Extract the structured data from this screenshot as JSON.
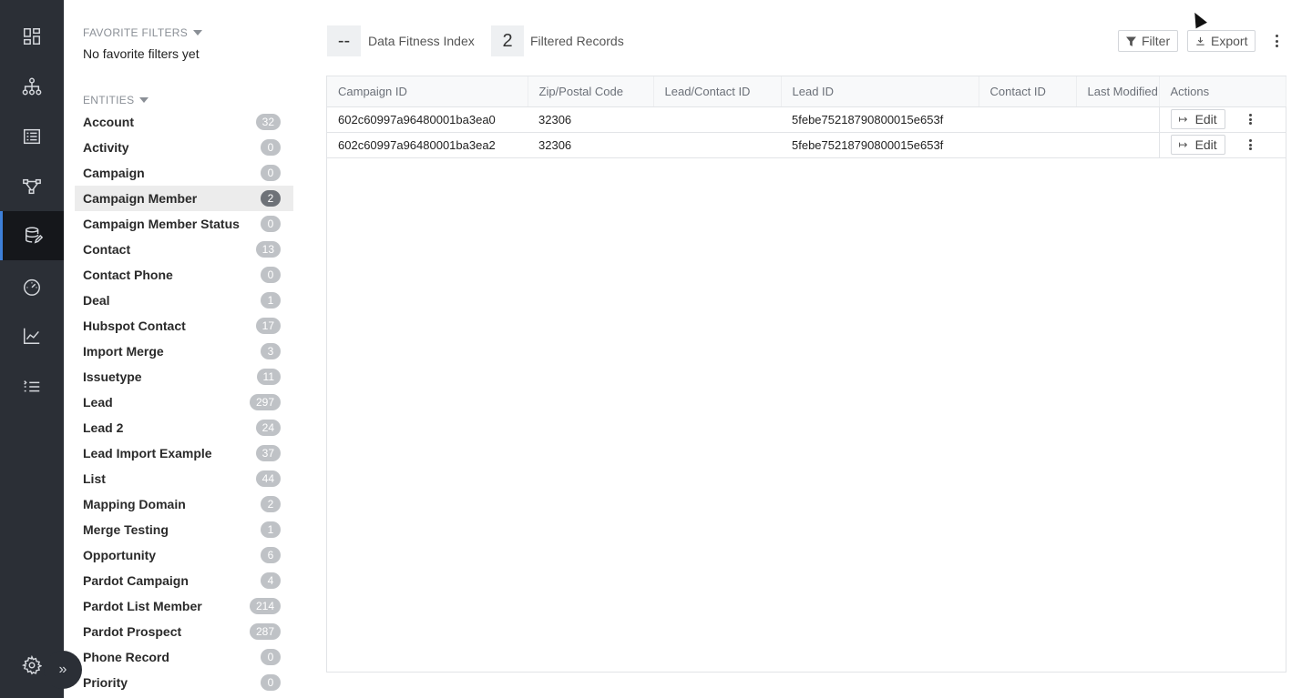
{
  "rail": {
    "items": [
      {
        "icon": "dashboard-icon"
      },
      {
        "icon": "hierarchy-icon"
      },
      {
        "icon": "list-view-icon"
      },
      {
        "icon": "workflow-icon"
      },
      {
        "icon": "database-edit-icon",
        "active": true
      },
      {
        "icon": "speedometer-icon"
      },
      {
        "icon": "line-chart-icon"
      },
      {
        "icon": "task-list-icon"
      }
    ],
    "settings_icon": "gear-icon",
    "expand_label": "»"
  },
  "sidebar": {
    "favorites_title": "FAVORITE FILTERS",
    "favorites_empty": "No favorite filters yet",
    "entities_title": "ENTITIES",
    "entities": [
      {
        "name": "Account",
        "count": "32"
      },
      {
        "name": "Activity",
        "count": "0"
      },
      {
        "name": "Campaign",
        "count": "0"
      },
      {
        "name": "Campaign Member",
        "count": "2",
        "active": true
      },
      {
        "name": "Campaign Member Status",
        "count": "0"
      },
      {
        "name": "Contact",
        "count": "13"
      },
      {
        "name": "Contact Phone",
        "count": "0"
      },
      {
        "name": "Deal",
        "count": "1"
      },
      {
        "name": "Hubspot Contact",
        "count": "17"
      },
      {
        "name": "Import Merge",
        "count": "3"
      },
      {
        "name": "Issuetype",
        "count": "11"
      },
      {
        "name": "Lead",
        "count": "297"
      },
      {
        "name": "Lead 2",
        "count": "24"
      },
      {
        "name": "Lead Import Example",
        "count": "37"
      },
      {
        "name": "List",
        "count": "44"
      },
      {
        "name": "Mapping Domain",
        "count": "2"
      },
      {
        "name": "Merge Testing",
        "count": "1"
      },
      {
        "name": "Opportunity",
        "count": "6"
      },
      {
        "name": "Pardot Campaign",
        "count": "4"
      },
      {
        "name": "Pardot List Member",
        "count": "214"
      },
      {
        "name": "Pardot Prospect",
        "count": "287"
      },
      {
        "name": "Phone Record",
        "count": "0"
      },
      {
        "name": "Priority",
        "count": "0"
      }
    ]
  },
  "stats": {
    "fitness_value": "--",
    "fitness_label": "Data Fitness Index",
    "filtered_value": "2",
    "filtered_label": "Filtered Records"
  },
  "toolbar": {
    "filter_label": "Filter",
    "export_label": "Export"
  },
  "table": {
    "columns": [
      "Campaign ID",
      "Zip/Postal Code",
      "Lead/Contact ID",
      "Lead ID",
      "Contact ID",
      "Last Modified",
      "Actions"
    ],
    "rows": [
      {
        "campaign_id": "602c60997a96480001ba3ea0",
        "zip": "32306",
        "lead_contact_id": "",
        "lead_id": "5febe75218790800015e653f",
        "contact_id": "",
        "last_modified": "",
        "edit_label": "Edit"
      },
      {
        "campaign_id": "602c60997a96480001ba3ea2",
        "zip": "32306",
        "lead_contact_id": "",
        "lead_id": "5febe75218790800015e653f",
        "contact_id": "",
        "last_modified": "",
        "edit_label": "Edit"
      }
    ]
  }
}
